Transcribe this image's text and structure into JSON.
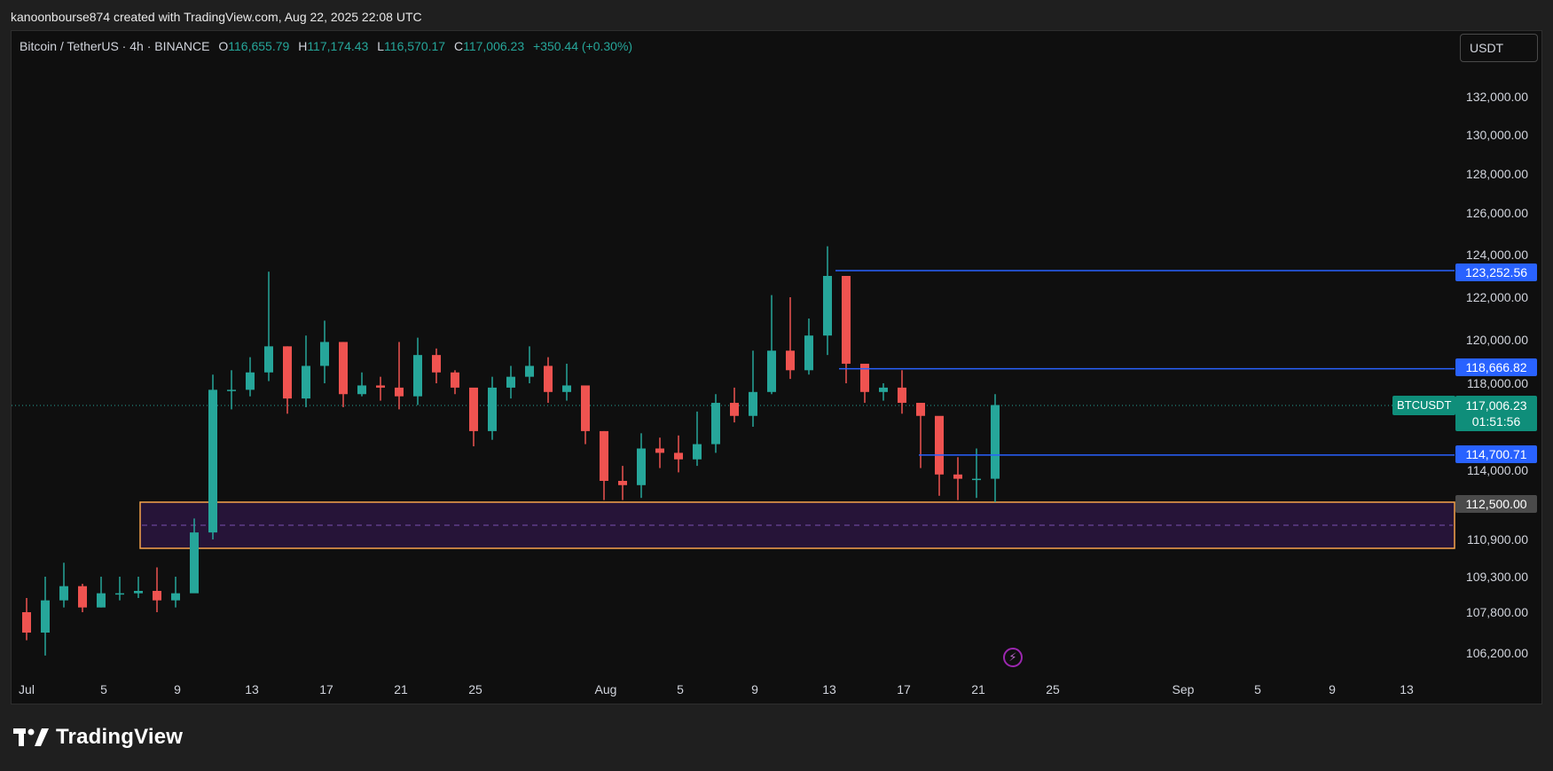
{
  "header": {
    "attribution": "kanoonbourse874 created with TradingView.com, Aug 22, 2025 22:08 UTC"
  },
  "legend": {
    "symbol": "Bitcoin / TetherUS · 4h · BINANCE",
    "open_key": "O",
    "open": "116,655.79",
    "high_key": "H",
    "high": "117,174.43",
    "low_key": "L",
    "low": "116,570.17",
    "close_key": "C",
    "close": "117,006.23",
    "change": "+350.44 (+0.30%)"
  },
  "currency_button": "USDT",
  "price_axis": {
    "ticks": [
      "132,000.00",
      "130,000.00",
      "128,000.00",
      "126,000.00",
      "124,000.00",
      "122,000.00",
      "120,000.00",
      "118,000.00",
      "114,000.00",
      "110,900.00",
      "109,300.00",
      "107,800.00",
      "106,200.00"
    ]
  },
  "time_axis": {
    "ticks": [
      "Jul",
      "5",
      "9",
      "13",
      "17",
      "21",
      "25",
      "Aug",
      "5",
      "9",
      "13",
      "17",
      "21",
      "25",
      "Sep",
      "5",
      "9",
      "13"
    ]
  },
  "levels": {
    "l1": "123,252.56",
    "l2": "118,666.82",
    "l3": "114,700.71",
    "zone_top": "112,500.00"
  },
  "last_price": {
    "symbol_tag": "BTCUSDT",
    "price": "117,006.23",
    "countdown": "01:51:56"
  },
  "colors": {
    "up": "#26a69a",
    "down": "#ef5350",
    "level_line": "#2962ff",
    "zone_border": "#f7a34b",
    "zone_fill": "#2a1540",
    "background": "#0f0f0f"
  },
  "footer": {
    "brand": "TradingView"
  },
  "chart_data": {
    "type": "candlestick",
    "title": "Bitcoin / TetherUS · 4h · BINANCE",
    "ylim": [
      105200,
      133200
    ],
    "x": [
      "Jul 1",
      "Jul 2",
      "Jul 3",
      "Jul 4",
      "Jul 5",
      "Jul 6",
      "Jul 7",
      "Jul 8",
      "Jul 9",
      "Jul 10",
      "Jul 11",
      "Jul 12",
      "Jul 13",
      "Jul 14",
      "Jul 15",
      "Jul 16",
      "Jul 17",
      "Jul 18",
      "Jul 19",
      "Jul 20",
      "Jul 21",
      "Jul 22",
      "Jul 23",
      "Jul 24",
      "Jul 25",
      "Jul 26",
      "Jul 27",
      "Jul 28",
      "Jul 29",
      "Jul 30",
      "Jul 31",
      "Aug 1",
      "Aug 2",
      "Aug 3",
      "Aug 4",
      "Aug 5",
      "Aug 6",
      "Aug 7",
      "Aug 8",
      "Aug 9",
      "Aug 10",
      "Aug 11",
      "Aug 12",
      "Aug 13",
      "Aug 14",
      "Aug 15",
      "Aug 16",
      "Aug 17",
      "Aug 18",
      "Aug 19",
      "Aug 20",
      "Aug 21",
      "Aug 22"
    ],
    "close": [
      107000,
      108300,
      108900,
      108000,
      108600,
      108600,
      108700,
      108300,
      108600,
      111200,
      117700,
      117700,
      118500,
      119700,
      117300,
      118800,
      119900,
      117500,
      117900,
      117800,
      117400,
      119300,
      118500,
      117800,
      115800,
      117800,
      118300,
      118800,
      117600,
      117900,
      115800,
      113500,
      113300,
      115000,
      114800,
      114500,
      115200,
      117100,
      116500,
      117600,
      119500,
      118600,
      120200,
      123000,
      118900,
      117600,
      117800,
      117100,
      116500,
      113800,
      113600,
      113600,
      117000
    ],
    "high": [
      108400,
      109300,
      109900,
      109000,
      109300,
      109300,
      109300,
      109700,
      109300,
      111800,
      118400,
      118600,
      119200,
      123200,
      119700,
      120200,
      120900,
      119900,
      118500,
      118300,
      119900,
      120100,
      119600,
      118600,
      117700,
      118300,
      118800,
      119700,
      119200,
      118900,
      116400,
      115800,
      114200,
      115700,
      115500,
      115600,
      116700,
      117500,
      117800,
      119500,
      122100,
      122000,
      121000,
      124400,
      121000,
      118300,
      118000,
      118600,
      117100,
      114800,
      114600,
      115000,
      117500
    ],
    "low": [
      106700,
      106100,
      108000,
      107800,
      108000,
      108300,
      108400,
      107800,
      108000,
      109100,
      110900,
      116800,
      117400,
      118100,
      116600,
      116900,
      118000,
      116900,
      117400,
      117200,
      116800,
      117000,
      118000,
      117500,
      115100,
      115400,
      117300,
      118000,
      117100,
      117200,
      115200,
      112600,
      112600,
      112700,
      114100,
      113900,
      114200,
      114800,
      116200,
      116000,
      117500,
      118200,
      118400,
      119300,
      118000,
      117100,
      117200,
      116600,
      114100,
      112800,
      112600,
      112700,
      112500
    ]
  }
}
